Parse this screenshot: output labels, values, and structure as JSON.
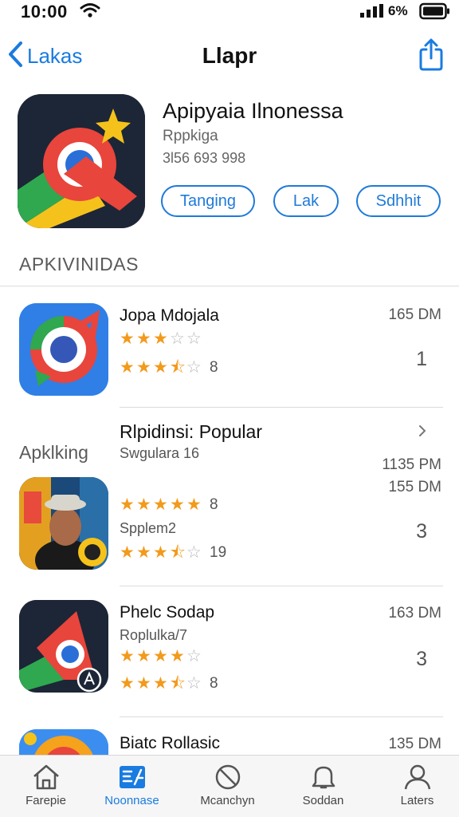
{
  "status_bar": {
    "time": "10:00",
    "battery_pct": "6%"
  },
  "nav": {
    "back_label": "Lakas",
    "title": "Llapr"
  },
  "hero": {
    "title": "Apipyaia Ilnonessa",
    "subtitle": "Rppkiga",
    "meta": "3l56 693 998",
    "buttons": [
      "Tanging",
      "Lak",
      "Sdhhit"
    ]
  },
  "section_header": "APKIVINIDAS",
  "apps": [
    {
      "name": "Jopa Mdojala",
      "subtitle": "",
      "time": "165 DM",
      "rank": "1",
      "rating1": 3,
      "rating2": 3.5,
      "rating2_label": "8"
    },
    {
      "name": "",
      "subtitle": "Spplem2",
      "time": "155 DM",
      "rank": "3",
      "rating1": 5,
      "rating1_label": "8",
      "rating2": 3.5,
      "rating2_label": "19"
    },
    {
      "name": "Phelc Sodap",
      "subtitle": "Roplulka/7",
      "time": "163 DM",
      "rank": "3",
      "rating1": 4,
      "rating2": 3.5,
      "rating2_label": "8"
    },
    {
      "name": "Biatc Rollasic",
      "time": "135 DM"
    }
  ],
  "popular": {
    "side_label": "Apklking",
    "heading": "Rlpidinsi: Popular",
    "subheading": "Swgulara 16",
    "time": "1135 PM"
  },
  "tabs": [
    {
      "label": "Farepie",
      "icon": "home-icon"
    },
    {
      "label": "Noonnase",
      "icon": "apps-icon"
    },
    {
      "label": "Mcanchyn",
      "icon": "blocked-icon"
    },
    {
      "label": "Soddan",
      "icon": "bell-icon"
    },
    {
      "label": "Laters",
      "icon": "person-icon"
    }
  ],
  "colors": {
    "accent": "#1a7be0",
    "star": "#f29a1c",
    "star_empty": "#b8b8b8",
    "tabbar": "#f6f6f6"
  }
}
